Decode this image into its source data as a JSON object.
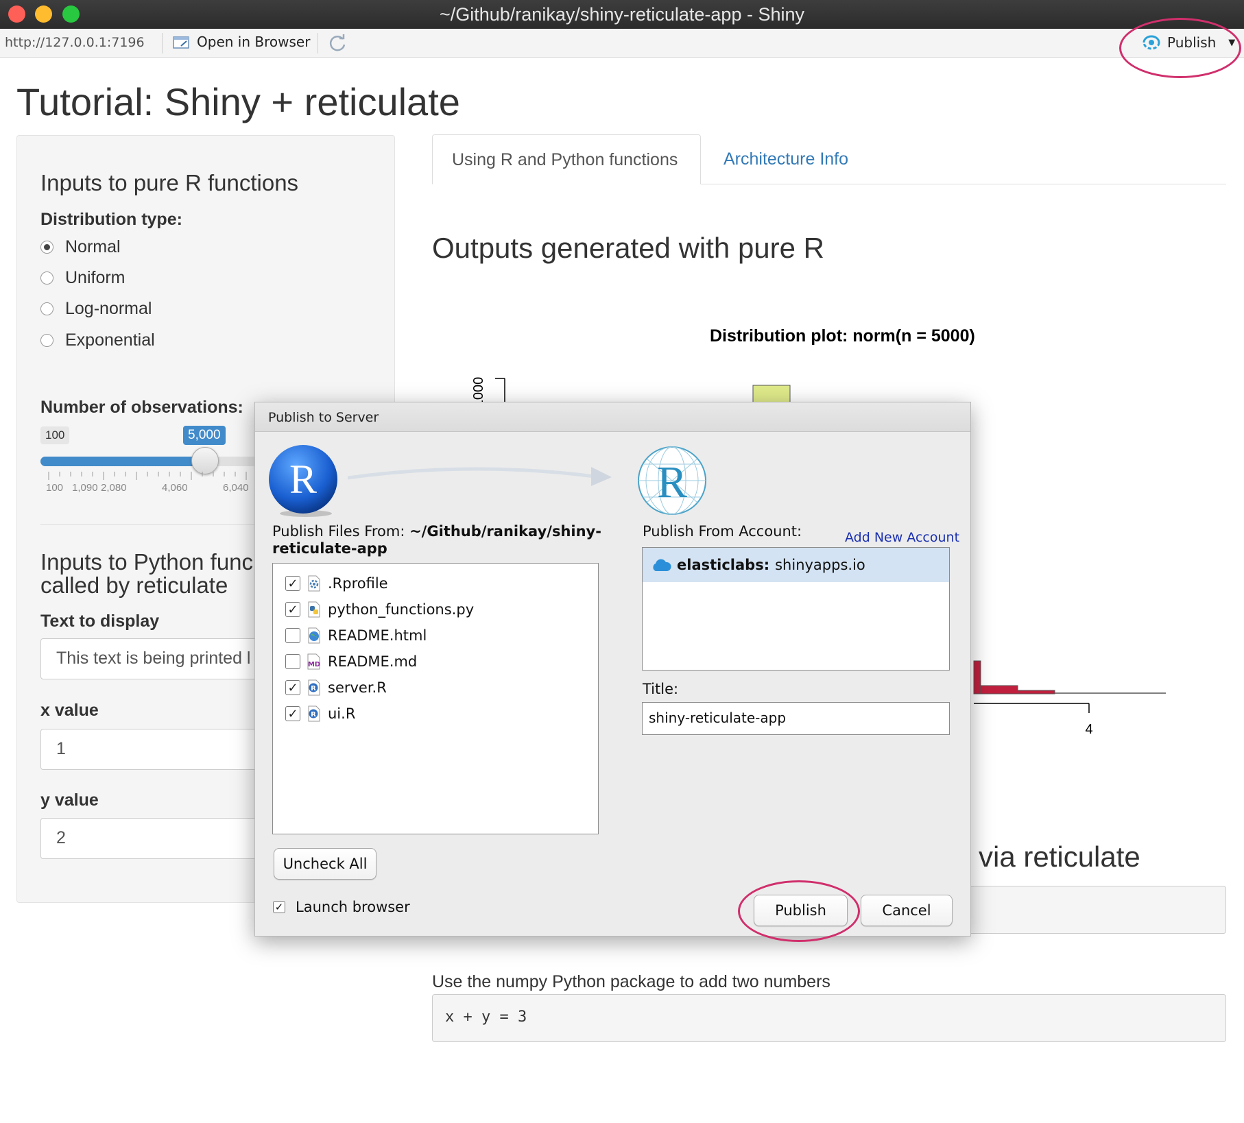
{
  "window": {
    "title": "~/Github/ranikay/shiny-reticulate-app - Shiny"
  },
  "toolbar": {
    "url": "http://127.0.0.1:7196",
    "open_in_browser_label": "Open in Browser",
    "publish_label": "Publish"
  },
  "page": {
    "title": "Tutorial: Shiny + reticulate"
  },
  "sidebar": {
    "r_heading": "Inputs to pure R functions",
    "dist_label": "Distribution type:",
    "dist_options": [
      "Normal",
      "Uniform",
      "Log-normal",
      "Exponential"
    ],
    "dist_selected": "Normal",
    "obs_label": "Number of observations:",
    "slider": {
      "min_label": "100",
      "value_label": "5,000",
      "value": 5000,
      "min": 100,
      "tick_labels": [
        "100",
        "1,090",
        "2,080",
        "4,060",
        "6,040"
      ]
    },
    "py_heading_line1": "Inputs to Python func",
    "py_heading_line2": "called by reticulate",
    "text_label": "Text to display",
    "text_value": "This text is being printed l",
    "x_label": "x value",
    "x_value": "1",
    "y_label": "y value",
    "y_value": "2"
  },
  "main": {
    "tabs": [
      {
        "label": "Using R and Python functions",
        "active": true
      },
      {
        "label": "Architecture Info",
        "active": false
      }
    ],
    "outputs_heading": "Outputs generated with pure R",
    "plot": {
      "title": "Distribution plot: norm(n = 5000)",
      "y_tick_label": "1000",
      "x_tick_label": "4"
    },
    "via_heading": "via reticulate",
    "numpy_label": "Use the numpy Python package to add two numbers",
    "numpy_output": "x + y = 3"
  },
  "dialog": {
    "title": "Publish to Server",
    "files_from_label": "Publish Files From: ",
    "files_from_path_line1": "~/Github/ranikay/shiny-",
    "files_from_path_line2": "reticulate-app",
    "files": [
      {
        "name": ".Rprofile",
        "checked": true,
        "icon": "gear-file-icon"
      },
      {
        "name": "python_functions.py",
        "checked": true,
        "icon": "python-file-icon"
      },
      {
        "name": "README.html",
        "checked": false,
        "icon": "html-file-icon"
      },
      {
        "name": "README.md",
        "checked": false,
        "icon": "markdown-file-icon"
      },
      {
        "name": "server.R",
        "checked": true,
        "icon": "r-file-icon"
      },
      {
        "name": "ui.R",
        "checked": true,
        "icon": "r-file-icon"
      }
    ],
    "account_label": "Publish From Account:",
    "add_account_label": "Add New Account",
    "account": {
      "name": "elasticlabs:",
      "server": "shinyapps.io"
    },
    "title_label": "Title:",
    "title_value": "shiny-reticulate-app",
    "uncheck_all_label": "Uncheck All",
    "launch_browser_label": "Launch browser",
    "launch_browser_checked": true,
    "publish_label": "Publish",
    "cancel_label": "Cancel"
  },
  "colors": {
    "accent": "#337ab7",
    "annotation": "#d02f6c",
    "slider_fill": "#428bca",
    "hist_red": "#c0203e",
    "hist_yellow": "#dfea8a"
  }
}
